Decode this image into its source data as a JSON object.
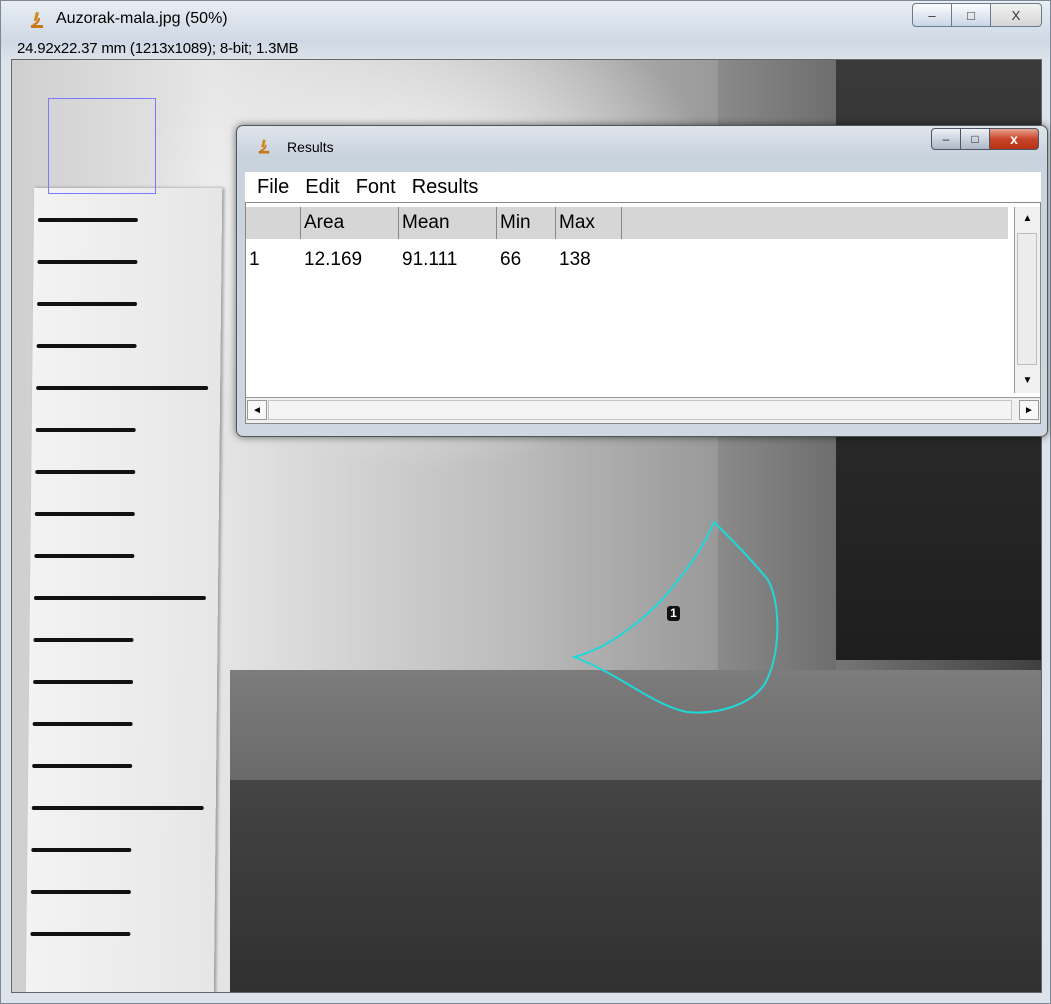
{
  "app_window": {
    "title": "Auzorak-mala.jpg (50%)",
    "icon": "microscope-icon",
    "info": "24.92x22.37 mm (1213x1089); 8-bit; 1.3MB",
    "controls": {
      "minimize": "–",
      "maximize": "□",
      "close": "X"
    }
  },
  "image": {
    "roi_label": "1",
    "roi_color": "#20d8d8",
    "navigator_color": "#7a7aff"
  },
  "results_window": {
    "title": "Results",
    "icon": "microscope-icon",
    "controls": {
      "minimize": "–",
      "maximize": "□",
      "close": "x"
    },
    "menu": [
      "File",
      "Edit",
      "Font",
      "Results"
    ],
    "columns": [
      "",
      "Area",
      "Mean",
      "Min",
      "Max"
    ],
    "rows": [
      [
        "1",
        "12.169",
        "91.111",
        "66",
        "138"
      ]
    ],
    "scroll_up": "▲",
    "scroll_down": "▼",
    "scroll_left": "◄",
    "scroll_right": "►"
  }
}
